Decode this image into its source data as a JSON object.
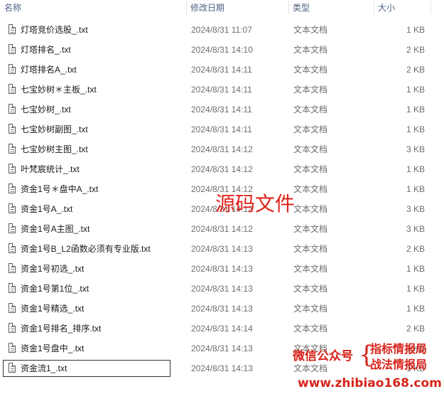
{
  "columns": {
    "name": "名称",
    "date": "修改日期",
    "type": "类型",
    "size": "大小"
  },
  "files": [
    {
      "name": "灯塔竞价选股_.txt",
      "date": "2024/8/31 11:07",
      "type": "文本文档",
      "size": "1 KB"
    },
    {
      "name": "灯塔排名_.txt",
      "date": "2024/8/31 14:10",
      "type": "文本文档",
      "size": "2 KB"
    },
    {
      "name": "灯塔排名A_.txt",
      "date": "2024/8/31 14:11",
      "type": "文本文档",
      "size": "2 KB"
    },
    {
      "name": "七宝妙树＊主板_.txt",
      "date": "2024/8/31 14:11",
      "type": "文本文档",
      "size": "1 KB"
    },
    {
      "name": "七宝妙树_.txt",
      "date": "2024/8/31 14:11",
      "type": "文本文档",
      "size": "1 KB"
    },
    {
      "name": "七宝妙树副图_.txt",
      "date": "2024/8/31 14:11",
      "type": "文本文档",
      "size": "1 KB"
    },
    {
      "name": "七宝妙树主图_.txt",
      "date": "2024/8/31 14:12",
      "type": "文本文档",
      "size": "3 KB"
    },
    {
      "name": "叶梵宸统计_.txt",
      "date": "2024/8/31 14:12",
      "type": "文本文档",
      "size": "1 KB"
    },
    {
      "name": "资金1号＊盘中A_.txt",
      "date": "2024/8/31 14:12",
      "type": "文本文档",
      "size": "1 KB"
    },
    {
      "name": "资金1号A_.txt",
      "date": "2024/8/31 14:12",
      "type": "文本文档",
      "size": "3 KB"
    },
    {
      "name": "资金1号A主图_.txt",
      "date": "2024/8/31 14:12",
      "type": "文本文档",
      "size": "3 KB"
    },
    {
      "name": "资金1号B_L2函数必须有专业版.txt",
      "date": "2024/8/31 14:13",
      "type": "文本文档",
      "size": "2 KB"
    },
    {
      "name": "资金1号初选_.txt",
      "date": "2024/8/31 14:13",
      "type": "文本文档",
      "size": "1 KB"
    },
    {
      "name": "资金1号第1位_.txt",
      "date": "2024/8/31 14:13",
      "type": "文本文档",
      "size": "1 KB"
    },
    {
      "name": "资金1号精选_.txt",
      "date": "2024/8/31 14:13",
      "type": "文本文档",
      "size": "1 KB"
    },
    {
      "name": "资金1号排名_排序.txt",
      "date": "2024/8/31 14:14",
      "type": "文本文档",
      "size": "2 KB"
    },
    {
      "name": "资金1号盘中_.txt",
      "date": "2024/8/31 14:13",
      "type": "文本文档",
      "size": "1 KB"
    },
    {
      "name": "资金流1_.txt",
      "date": "2024/8/31 14:13",
      "type": "文本文档",
      "size": "1 KB"
    }
  ],
  "selected_index": 17,
  "watermark": {
    "center": "源码文件",
    "wechat": "微信公众号",
    "brace": "{",
    "line1": "指标情报局",
    "line2": "战法情报局",
    "url": "www.zhibiao168.com",
    "color": "#d8231a"
  }
}
